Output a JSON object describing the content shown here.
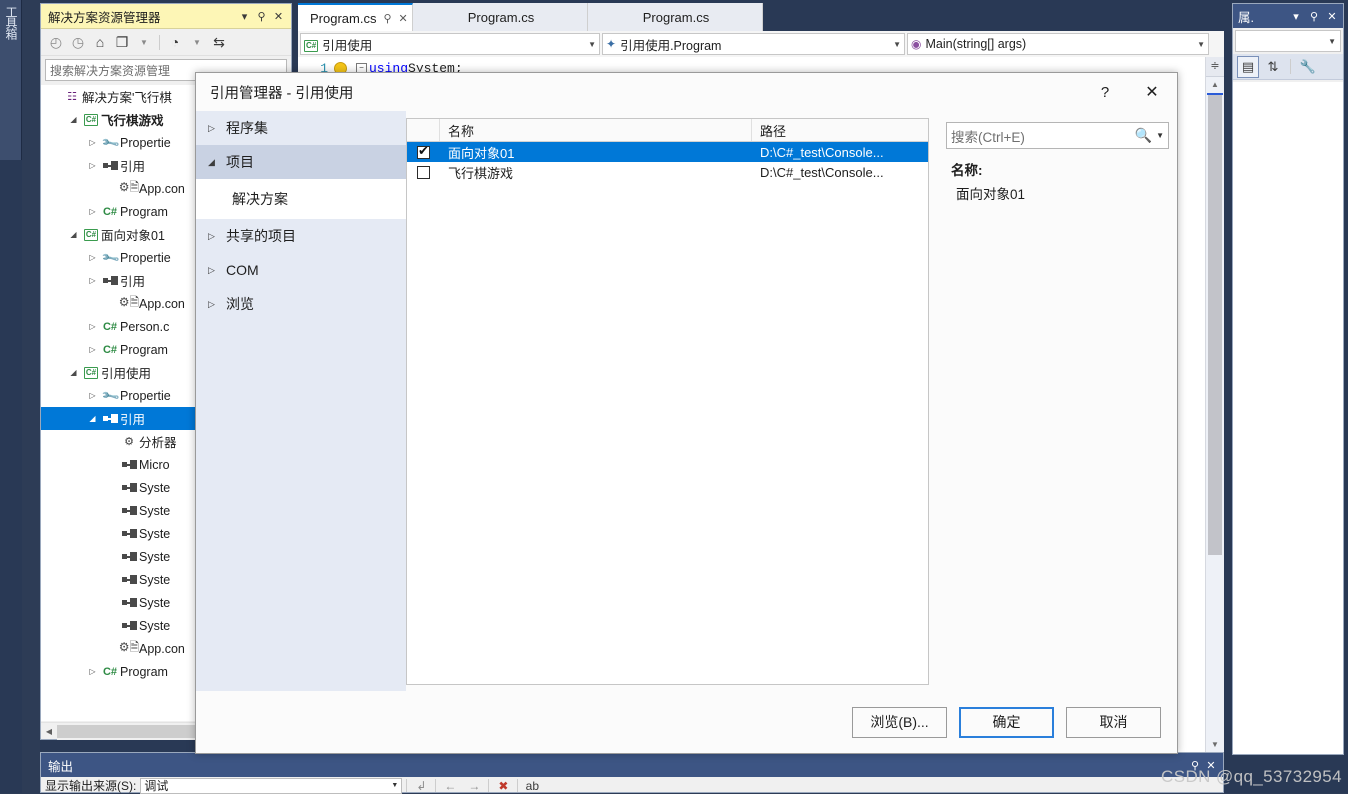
{
  "shell": {
    "toolbox_tab": "工具箱"
  },
  "solution_explorer": {
    "title": "解决方案资源管理器",
    "titlebar_buttons": {
      "dropdown": "▾",
      "pin": "⚐",
      "close": "✕"
    },
    "toolbar_icons": [
      "back-arrow",
      "forward-arrow",
      "home",
      "sync-with-active-document",
      "pending-changes",
      "refresh"
    ],
    "search_placeholder": "搜索解决方案资源管理",
    "tree": [
      {
        "label": "解决方案'飞行棋",
        "icon": "solution-icon",
        "indent": 0,
        "arrow": "",
        "bold": false
      },
      {
        "label": "飞行棋游戏",
        "icon": "csharp-project-icon",
        "indent": 1,
        "arrow": "▲",
        "bold": true
      },
      {
        "label": "Propertie",
        "icon": "wrench-icon",
        "indent": 2,
        "arrow": "▷",
        "bold": false
      },
      {
        "label": "引用",
        "icon": "references-icon",
        "indent": 2,
        "arrow": "▷",
        "bold": false
      },
      {
        "label": "App.con",
        "icon": "config-file-icon",
        "indent": 3,
        "arrow": "",
        "bold": false
      },
      {
        "label": "Program",
        "icon": "csharp-file-icon",
        "indent": 2,
        "arrow": "▷",
        "bold": false
      },
      {
        "label": "面向对象01",
        "icon": "csharp-project-icon",
        "indent": 1,
        "arrow": "▲",
        "bold": false
      },
      {
        "label": "Propertie",
        "icon": "wrench-icon",
        "indent": 2,
        "arrow": "▷",
        "bold": false
      },
      {
        "label": "引用",
        "icon": "references-icon",
        "indent": 2,
        "arrow": "▷",
        "bold": false
      },
      {
        "label": "App.con",
        "icon": "config-file-icon",
        "indent": 3,
        "arrow": "",
        "bold": false
      },
      {
        "label": "Person.c",
        "icon": "csharp-file-icon",
        "indent": 2,
        "arrow": "▷",
        "bold": false
      },
      {
        "label": "Program",
        "icon": "csharp-file-icon",
        "indent": 2,
        "arrow": "▷",
        "bold": false
      },
      {
        "label": "引用使用",
        "icon": "csharp-project-icon",
        "indent": 1,
        "arrow": "▲",
        "bold": false
      },
      {
        "label": "Propertie",
        "icon": "wrench-icon",
        "indent": 2,
        "arrow": "▷",
        "bold": false
      },
      {
        "label": "引用",
        "icon": "references-icon",
        "indent": 2,
        "arrow": "▲",
        "bold": false,
        "selected": true
      },
      {
        "label": "分析器",
        "icon": "analyzer-icon",
        "indent": 3,
        "arrow": "",
        "bold": false
      },
      {
        "label": "Micro",
        "icon": "reference-item-icon",
        "indent": 3,
        "arrow": "",
        "bold": false
      },
      {
        "label": "Syste",
        "icon": "reference-item-icon",
        "indent": 3,
        "arrow": "",
        "bold": false
      },
      {
        "label": "Syste",
        "icon": "reference-item-icon",
        "indent": 3,
        "arrow": "",
        "bold": false
      },
      {
        "label": "Syste",
        "icon": "reference-item-icon",
        "indent": 3,
        "arrow": "",
        "bold": false
      },
      {
        "label": "Syste",
        "icon": "reference-item-icon",
        "indent": 3,
        "arrow": "",
        "bold": false
      },
      {
        "label": "Syste",
        "icon": "reference-item-icon",
        "indent": 3,
        "arrow": "",
        "bold": false
      },
      {
        "label": "Syste",
        "icon": "reference-item-icon",
        "indent": 3,
        "arrow": "",
        "bold": false
      },
      {
        "label": "Syste",
        "icon": "reference-item-icon",
        "indent": 3,
        "arrow": "",
        "bold": false
      },
      {
        "label": "App.con",
        "icon": "config-file-icon",
        "indent": 3,
        "arrow": "",
        "bold": false
      },
      {
        "label": "Program",
        "icon": "csharp-file-icon",
        "indent": 2,
        "arrow": "▷",
        "bold": false
      }
    ]
  },
  "editor": {
    "tabs": [
      {
        "label": "Program.cs",
        "active": true,
        "pin": "⚐",
        "close": "✕"
      },
      {
        "label": "Program.cs",
        "active": false
      },
      {
        "label": "Program.cs",
        "active": false
      }
    ],
    "nav_dropdowns": [
      {
        "icon": "csharp-project-icon",
        "value": "引用使用"
      },
      {
        "icon": "class-icon",
        "value": "引用使用.Program"
      },
      {
        "icon": "method-icon",
        "value": "Main(string[] args)"
      }
    ],
    "code": {
      "line_number": "1",
      "text_keyword": "using",
      "text_rest": " System;"
    }
  },
  "properties_panel": {
    "title": "属.",
    "buttons": {
      "dropdown": "▾",
      "pin": "⚐",
      "close": "✕"
    },
    "tools": [
      "categorized-icon",
      "alphabetical-sort-icon",
      "properties-wrench-icon"
    ]
  },
  "output_panel": {
    "title": "输出",
    "buttons": {
      "pin": "⚐",
      "close": "✕"
    },
    "source_label": "显示输出来源(S):",
    "source_value": "调试",
    "toolbar_icons": [
      "wrap-text-icon",
      "prev-arrow-icon",
      "next-arrow-icon",
      "clear-all-icon",
      "toggle-word-wrap-icon"
    ]
  },
  "dialog": {
    "title": "引用管理器 - 引用使用",
    "help_button": "?",
    "close_button": "✕",
    "nav": [
      {
        "label": "程序集",
        "arrow": "▷",
        "selected": false
      },
      {
        "label": "项目",
        "arrow": "◢",
        "selected": true
      },
      {
        "label": "解决方案",
        "sub": true
      },
      {
        "label": "共享的项目",
        "arrow": "▷",
        "selected": false
      },
      {
        "label": "COM",
        "arrow": "▷",
        "selected": false
      },
      {
        "label": "浏览",
        "arrow": "▷",
        "selected": false
      }
    ],
    "list": {
      "columns": [
        "名称",
        "路径"
      ],
      "rows": [
        {
          "checked": true,
          "name": "面向对象01",
          "path": "D:\\C#_test\\Console...",
          "selected": true
        },
        {
          "checked": false,
          "name": "飞行棋游戏",
          "path": "D:\\C#_test\\Console...",
          "selected": false
        }
      ]
    },
    "search_placeholder": "搜索(Ctrl+E)",
    "detail": {
      "label": "名称:",
      "value": "面向对象01"
    },
    "footer_buttons": [
      {
        "id": "browse",
        "label": "浏览(B)...",
        "default": false
      },
      {
        "id": "ok",
        "label": "确定",
        "default": true
      },
      {
        "id": "cancel",
        "label": "取消",
        "default": false
      }
    ]
  },
  "watermark": "CSDN @qq_53732954"
}
